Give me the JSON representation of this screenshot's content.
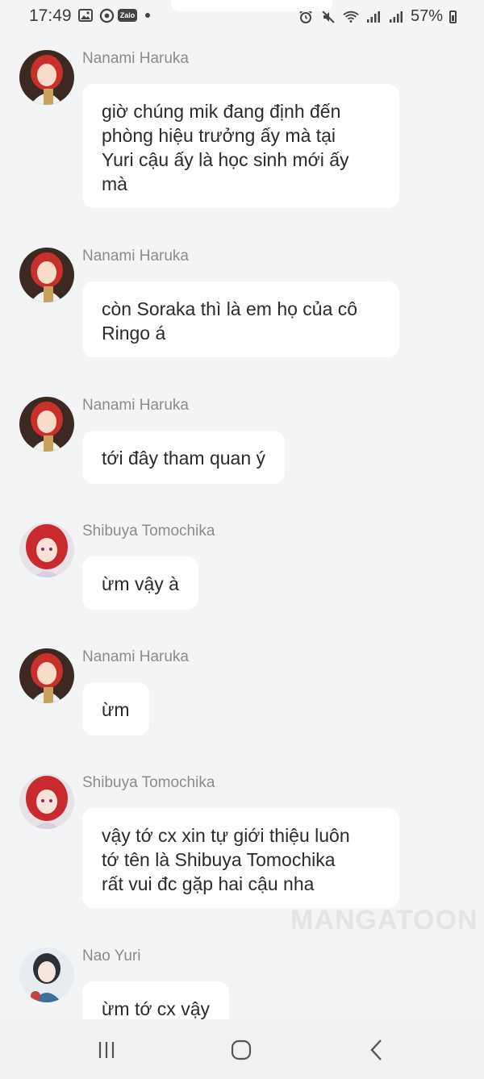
{
  "status_bar": {
    "time": "17:49",
    "left_icons": [
      "image-icon",
      "messenger-icon",
      "zalo-icon",
      "notification-dot-icon"
    ],
    "zalo_label": "Zalo",
    "right_icons": [
      "alarm-icon",
      "mute-icon",
      "wifi-icon",
      "signal-icon",
      "signal-icon"
    ],
    "battery_percent": "57%"
  },
  "messages": [
    {
      "sender": "Nanami Haruka",
      "avatar": "nanami-avatar",
      "text": "giờ chúng mik đang định đến\nphòng hiệu trưởng ấy mà tại\nYuri cậu ấy là học sinh mới ấy\nmà"
    },
    {
      "sender": "Nanami Haruka",
      "avatar": "nanami-avatar",
      "text": "còn Soraka thì là em họ của cô\nRingo á"
    },
    {
      "sender": "Nanami Haruka",
      "avatar": "nanami-avatar",
      "text": "tới đây tham quan ý"
    },
    {
      "sender": "Shibuya Tomochika",
      "avatar": "shibuya-avatar",
      "text": "ừm vậy à"
    },
    {
      "sender": "Nanami Haruka",
      "avatar": "nanami-avatar",
      "text": "ừm"
    },
    {
      "sender": "Shibuya Tomochika",
      "avatar": "shibuya-avatar",
      "text": "vậy tớ cx xin tự giới thiệu luôn\ntớ tên là Shibuya Tomochika\nrất vui đc gặp hai cậu nha"
    },
    {
      "sender": "Nao Yuri",
      "avatar": "nao-avatar",
      "text": "ừm tớ cx vậy"
    }
  ],
  "watermark": "MANGATOON",
  "nav_bar": {
    "buttons": [
      "recent-apps-icon",
      "home-icon",
      "back-icon"
    ]
  },
  "colors": {
    "background": "#f3f4f6",
    "bubble": "#ffffff",
    "name_text": "#8b8b8b",
    "message_text": "#2b2b2b"
  }
}
